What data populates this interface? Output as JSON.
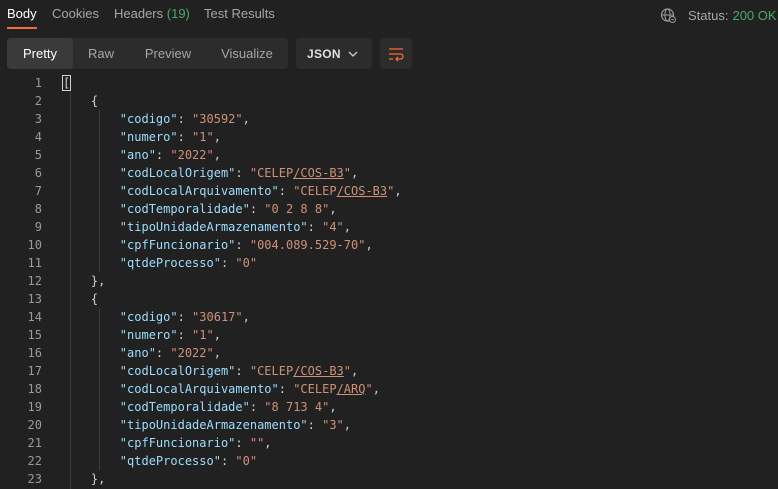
{
  "tabs": [
    {
      "label": "Body",
      "active": true
    },
    {
      "label": "Cookies",
      "active": false
    },
    {
      "label": "Headers",
      "count": "(19)",
      "active": false
    },
    {
      "label": "Test Results",
      "active": false
    }
  ],
  "status": {
    "label": "Status:",
    "value": "200 OK",
    "icon": "globe-icon"
  },
  "view_modes": [
    "Pretty",
    "Raw",
    "Preview",
    "Visualize"
  ],
  "active_view": "Pretty",
  "format_select": {
    "value": "JSON",
    "icon": "chevron-down-icon"
  },
  "wrap_icon": "wrap-lines-icon",
  "colors": {
    "accent": "#f26b3a",
    "status_ok": "#4ca86b",
    "key": "#9cdcfe",
    "string": "#ce9178"
  },
  "lines": [
    {
      "n": "1",
      "parts": [
        {
          "t": "[",
          "c": "p"
        }
      ]
    },
    {
      "n": "2",
      "parts": [
        {
          "t": "    {",
          "c": "p"
        }
      ]
    },
    {
      "n": "3",
      "parts": [
        {
          "t": "        ",
          "c": "p"
        },
        {
          "t": "\"codigo\"",
          "c": "k"
        },
        {
          "t": ": ",
          "c": "p"
        },
        {
          "t": "\"30592\"",
          "c": "s"
        },
        {
          "t": ",",
          "c": "p"
        }
      ]
    },
    {
      "n": "4",
      "parts": [
        {
          "t": "        ",
          "c": "p"
        },
        {
          "t": "\"numero\"",
          "c": "k"
        },
        {
          "t": ": ",
          "c": "p"
        },
        {
          "t": "\"1\"",
          "c": "s"
        },
        {
          "t": ",",
          "c": "p"
        }
      ]
    },
    {
      "n": "5",
      "parts": [
        {
          "t": "        ",
          "c": "p"
        },
        {
          "t": "\"ano\"",
          "c": "k"
        },
        {
          "t": ": ",
          "c": "p"
        },
        {
          "t": "\"2022\"",
          "c": "s"
        },
        {
          "t": ",",
          "c": "p"
        }
      ]
    },
    {
      "n": "6",
      "parts": [
        {
          "t": "        ",
          "c": "p"
        },
        {
          "t": "\"codLocalOrigem\"",
          "c": "k"
        },
        {
          "t": ": ",
          "c": "p"
        },
        {
          "t": "\"CELEP",
          "c": "s"
        },
        {
          "t": "/COS-B3",
          "c": "s u"
        },
        {
          "t": "\"",
          "c": "s"
        },
        {
          "t": ",",
          "c": "p"
        }
      ]
    },
    {
      "n": "7",
      "parts": [
        {
          "t": "        ",
          "c": "p"
        },
        {
          "t": "\"codLocalArquivamento\"",
          "c": "k"
        },
        {
          "t": ": ",
          "c": "p"
        },
        {
          "t": "\"CELEP",
          "c": "s"
        },
        {
          "t": "/COS-B3",
          "c": "s u"
        },
        {
          "t": "\"",
          "c": "s"
        },
        {
          "t": ",",
          "c": "p"
        }
      ]
    },
    {
      "n": "8",
      "parts": [
        {
          "t": "        ",
          "c": "p"
        },
        {
          "t": "\"codTemporalidade\"",
          "c": "k"
        },
        {
          "t": ": ",
          "c": "p"
        },
        {
          "t": "\"0 2 8 8\"",
          "c": "s"
        },
        {
          "t": ",",
          "c": "p"
        }
      ]
    },
    {
      "n": "9",
      "parts": [
        {
          "t": "        ",
          "c": "p"
        },
        {
          "t": "\"tipoUnidadeArmazenamento\"",
          "c": "k"
        },
        {
          "t": ": ",
          "c": "p"
        },
        {
          "t": "\"4\"",
          "c": "s"
        },
        {
          "t": ",",
          "c": "p"
        }
      ]
    },
    {
      "n": "10",
      "parts": [
        {
          "t": "        ",
          "c": "p"
        },
        {
          "t": "\"cpfFuncionario\"",
          "c": "k"
        },
        {
          "t": ": ",
          "c": "p"
        },
        {
          "t": "\"004.089.529-70\"",
          "c": "s"
        },
        {
          "t": ",",
          "c": "p"
        }
      ]
    },
    {
      "n": "11",
      "parts": [
        {
          "t": "        ",
          "c": "p"
        },
        {
          "t": "\"qtdeProcesso\"",
          "c": "k"
        },
        {
          "t": ": ",
          "c": "p"
        },
        {
          "t": "\"0\"",
          "c": "s"
        }
      ]
    },
    {
      "n": "12",
      "parts": [
        {
          "t": "    },",
          "c": "p"
        }
      ]
    },
    {
      "n": "13",
      "parts": [
        {
          "t": "    {",
          "c": "p"
        }
      ]
    },
    {
      "n": "14",
      "parts": [
        {
          "t": "        ",
          "c": "p"
        },
        {
          "t": "\"codigo\"",
          "c": "k"
        },
        {
          "t": ": ",
          "c": "p"
        },
        {
          "t": "\"30617\"",
          "c": "s"
        },
        {
          "t": ",",
          "c": "p"
        }
      ]
    },
    {
      "n": "15",
      "parts": [
        {
          "t": "        ",
          "c": "p"
        },
        {
          "t": "\"numero\"",
          "c": "k"
        },
        {
          "t": ": ",
          "c": "p"
        },
        {
          "t": "\"1\"",
          "c": "s"
        },
        {
          "t": ",",
          "c": "p"
        }
      ]
    },
    {
      "n": "16",
      "parts": [
        {
          "t": "        ",
          "c": "p"
        },
        {
          "t": "\"ano\"",
          "c": "k"
        },
        {
          "t": ": ",
          "c": "p"
        },
        {
          "t": "\"2022\"",
          "c": "s"
        },
        {
          "t": ",",
          "c": "p"
        }
      ]
    },
    {
      "n": "17",
      "parts": [
        {
          "t": "        ",
          "c": "p"
        },
        {
          "t": "\"codLocalOrigem\"",
          "c": "k"
        },
        {
          "t": ": ",
          "c": "p"
        },
        {
          "t": "\"CELEP",
          "c": "s"
        },
        {
          "t": "/COS-B3",
          "c": "s u"
        },
        {
          "t": "\"",
          "c": "s"
        },
        {
          "t": ",",
          "c": "p"
        }
      ]
    },
    {
      "n": "18",
      "parts": [
        {
          "t": "        ",
          "c": "p"
        },
        {
          "t": "\"codLocalArquivamento\"",
          "c": "k"
        },
        {
          "t": ": ",
          "c": "p"
        },
        {
          "t": "\"CELEP",
          "c": "s"
        },
        {
          "t": "/ARQ",
          "c": "s u"
        },
        {
          "t": "\"",
          "c": "s"
        },
        {
          "t": ",",
          "c": "p"
        }
      ]
    },
    {
      "n": "19",
      "parts": [
        {
          "t": "        ",
          "c": "p"
        },
        {
          "t": "\"codTemporalidade\"",
          "c": "k"
        },
        {
          "t": ": ",
          "c": "p"
        },
        {
          "t": "\"8 713 4\"",
          "c": "s"
        },
        {
          "t": ",",
          "c": "p"
        }
      ]
    },
    {
      "n": "20",
      "parts": [
        {
          "t": "        ",
          "c": "p"
        },
        {
          "t": "\"tipoUnidadeArmazenamento\"",
          "c": "k"
        },
        {
          "t": ": ",
          "c": "p"
        },
        {
          "t": "\"3\"",
          "c": "s"
        },
        {
          "t": ",",
          "c": "p"
        }
      ]
    },
    {
      "n": "21",
      "parts": [
        {
          "t": "        ",
          "c": "p"
        },
        {
          "t": "\"cpfFuncionario\"",
          "c": "k"
        },
        {
          "t": ": ",
          "c": "p"
        },
        {
          "t": "\"\"",
          "c": "s"
        },
        {
          "t": ",",
          "c": "p"
        }
      ]
    },
    {
      "n": "22",
      "parts": [
        {
          "t": "        ",
          "c": "p"
        },
        {
          "t": "\"qtdeProcesso\"",
          "c": "k"
        },
        {
          "t": ": ",
          "c": "p"
        },
        {
          "t": "\"0\"",
          "c": "s"
        }
      ]
    },
    {
      "n": "23",
      "parts": [
        {
          "t": "    },",
          "c": "p"
        }
      ]
    }
  ]
}
